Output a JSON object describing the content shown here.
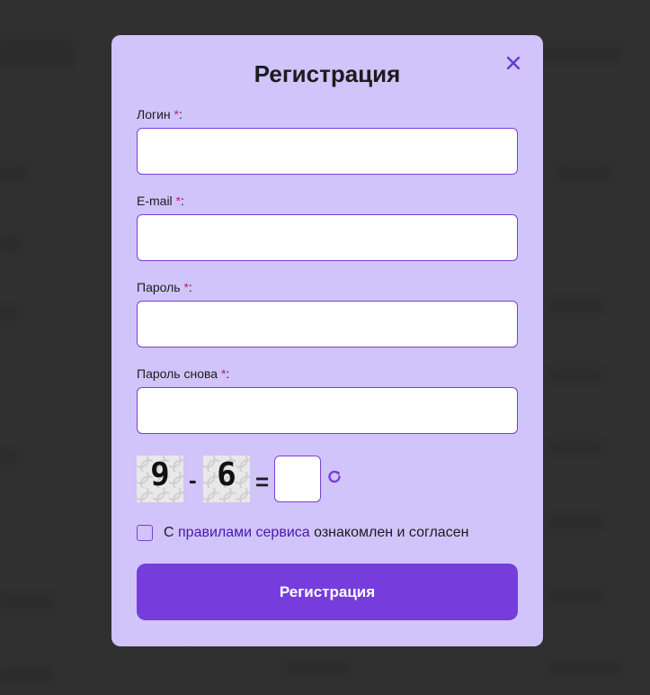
{
  "modal": {
    "title": "Регистрация",
    "close_icon": "close-icon",
    "fields": [
      {
        "label": "Логин",
        "required_mark": "*",
        "suffix": ":",
        "value": ""
      },
      {
        "label": "E-mail",
        "required_mark": "*",
        "suffix": ":",
        "value": ""
      },
      {
        "label": "Пароль",
        "required_mark": "*",
        "suffix": ":",
        "value": ""
      },
      {
        "label": "Пароль снова",
        "required_mark": "*",
        "suffix": ":",
        "value": ""
      }
    ],
    "captcha": {
      "operand1": "9",
      "operator": "-",
      "operand2": "6",
      "equals": "=",
      "answer": "",
      "refresh_icon": "refresh-icon"
    },
    "agreement": {
      "prefix": "С",
      "link_text": "правилами сервиса",
      "suffix": "ознакомлен и согласен",
      "checked": false
    },
    "submit_label": "Регистрация"
  },
  "colors": {
    "accent": "#763ddc",
    "modal_bg": "#d0c4fb",
    "required": "#c0206a"
  }
}
